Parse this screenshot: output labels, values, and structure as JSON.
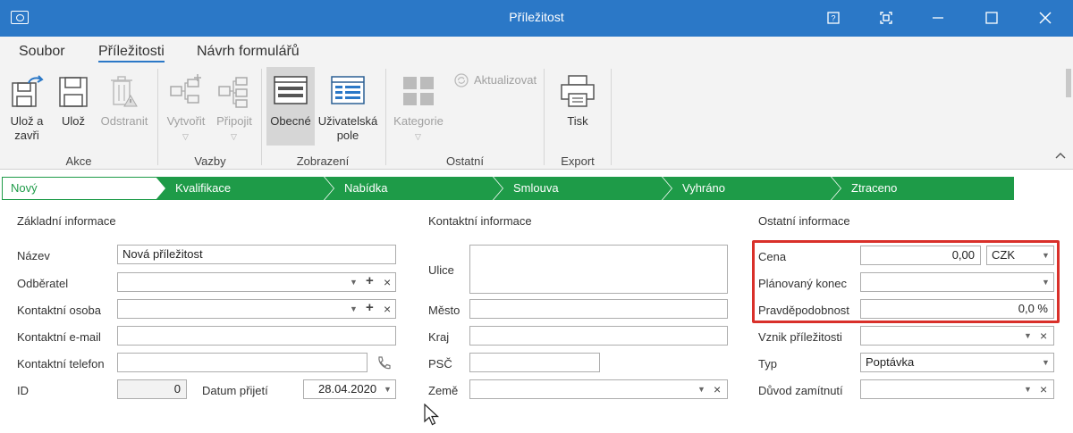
{
  "window": {
    "title": "Příležitost",
    "icons": [
      "app-icon",
      "help-icon",
      "fullscreen-icon",
      "minimize-icon",
      "maximize-icon",
      "close-icon"
    ]
  },
  "menu": {
    "tabs": [
      "Soubor",
      "Příležitosti",
      "Návrh formulářů"
    ],
    "active_tab": "Příležitosti"
  },
  "ribbon": {
    "groups": {
      "akce": "Akce",
      "vazby": "Vazby",
      "zobrazeni": "Zobrazení",
      "ostatni": "Ostatní",
      "export": "Export"
    },
    "buttons": {
      "uloz_zavri_1": "Ulož a",
      "uloz_zavri_2": "zavři",
      "uloz": "Ulož",
      "odstranit": "Odstranit",
      "vytvorit": "Vytvořit",
      "pripojit": "Připojit",
      "obecne": "Obecné",
      "uzivatelska_1": "Uživatelská",
      "uzivatelska_2": "pole",
      "kategorie": "Kategorie",
      "aktualizovat": "Aktualizovat",
      "tisk": "Tisk"
    }
  },
  "stages": [
    "Nový",
    "Kvalifikace",
    "Nabídka",
    "Smlouva",
    "Vyhráno",
    "Ztraceno"
  ],
  "colors": {
    "accent": "#2b78c7",
    "stage_green": "#1e9b48",
    "highlight": "#d9302a"
  },
  "sections": {
    "zakladni": {
      "title": "Základní informace",
      "nazev_label": "Název",
      "nazev_value": "Nová příležitost",
      "odberatel_label": "Odběratel",
      "kontaktni_osoba_label": "Kontaktní osoba",
      "email_label": "Kontaktní e-mail",
      "telefon_label": "Kontaktní telefon",
      "id_label": "ID",
      "id_value": "0",
      "datum_label": "Datum přijetí",
      "datum_value": "28.04.2020"
    },
    "kontaktni": {
      "title": "Kontaktní informace",
      "ulice_label": "Ulice",
      "mesto_label": "Město",
      "kraj_label": "Kraj",
      "psc_label": "PSČ",
      "zeme_label": "Země"
    },
    "ostatni": {
      "title": "Ostatní informace",
      "cena_label": "Cena",
      "cena_value": "0,00",
      "mena_value": "CZK",
      "konec_label": "Plánovaný konec",
      "pravdepodobnost_label": "Pravděpodobnost",
      "pravdepodobnost_value": "0,0 %",
      "vznik_label": "Vznik příležitosti",
      "typ_label": "Typ",
      "typ_value": "Poptávka",
      "duvod_label": "Důvod zamítnutí"
    }
  }
}
